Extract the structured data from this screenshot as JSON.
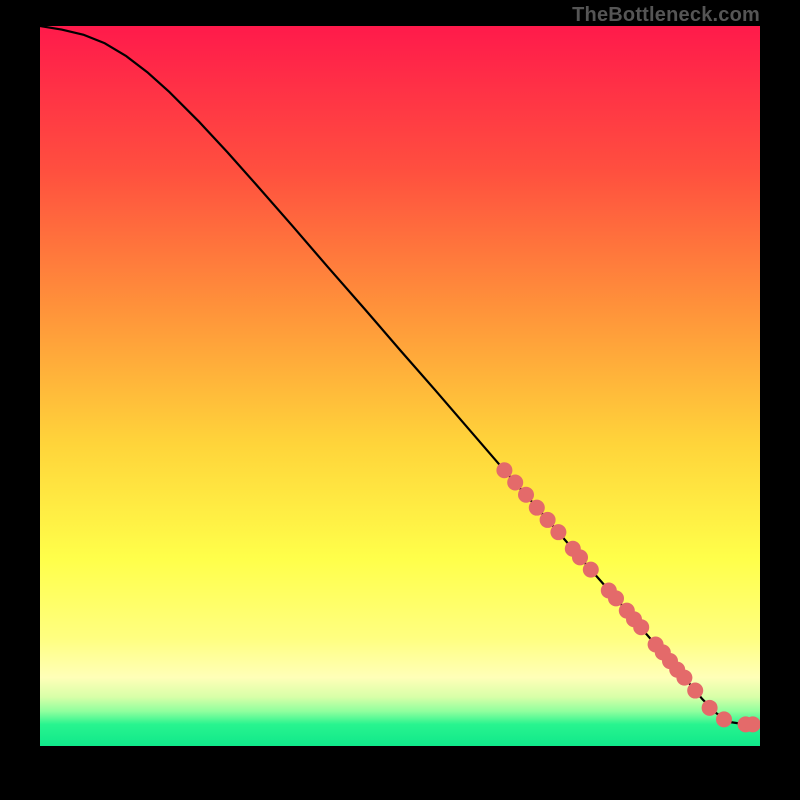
{
  "watermark": "TheBottleneck.com",
  "chart_data": {
    "type": "line",
    "title": "",
    "xlabel": "",
    "ylabel": "",
    "xlim": [
      0,
      100
    ],
    "ylim": [
      0,
      100
    ],
    "grid": false,
    "legend": false,
    "annotations": [],
    "gradient_stops": [
      {
        "offset": 0.0,
        "color": "#ff1a4b"
      },
      {
        "offset": 0.2,
        "color": "#ff4f3f"
      },
      {
        "offset": 0.4,
        "color": "#ff953a"
      },
      {
        "offset": 0.58,
        "color": "#ffd43a"
      },
      {
        "offset": 0.74,
        "color": "#ffff4a"
      },
      {
        "offset": 0.85,
        "color": "#ffff80"
      },
      {
        "offset": 0.905,
        "color": "#ffffb8"
      },
      {
        "offset": 0.932,
        "color": "#d8ffa8"
      },
      {
        "offset": 0.952,
        "color": "#8fff9e"
      },
      {
        "offset": 0.97,
        "color": "#28f48f"
      },
      {
        "offset": 1.0,
        "color": "#10e88a"
      }
    ],
    "series": [
      {
        "name": "curve",
        "type": "line",
        "color": "#000000",
        "x": [
          0,
          3,
          6,
          9,
          12,
          15,
          18,
          22,
          26,
          30,
          35,
          40,
          45,
          50,
          55,
          60,
          65,
          70,
          75,
          80,
          82,
          84,
          86,
          88,
          90,
          92,
          94,
          96,
          98,
          100
        ],
        "y": [
          100,
          99.5,
          98.8,
          97.6,
          95.8,
          93.5,
          90.8,
          86.8,
          82.5,
          78.0,
          72.3,
          66.5,
          60.8,
          55.0,
          49.3,
          43.5,
          37.7,
          32.0,
          26.2,
          20.5,
          18.2,
          15.8,
          13.5,
          11.2,
          8.9,
          6.5,
          4.5,
          3.3,
          3.0,
          3.0
        ]
      },
      {
        "name": "markers",
        "type": "scatter",
        "color": "#e46a6a",
        "x": [
          64.5,
          66.0,
          67.5,
          69.0,
          70.5,
          72.0,
          74.0,
          75.0,
          76.5,
          79.0,
          80.0,
          81.5,
          82.5,
          83.5,
          85.5,
          86.5,
          87.5,
          88.5,
          89.5,
          91.0,
          93.0,
          95.0,
          98.0,
          99.0
        ],
        "y": [
          38.3,
          36.6,
          34.9,
          33.1,
          31.4,
          29.7,
          27.4,
          26.2,
          24.5,
          21.6,
          20.5,
          18.8,
          17.6,
          16.5,
          14.1,
          13.0,
          11.8,
          10.6,
          9.5,
          7.7,
          5.3,
          3.7,
          3.0,
          3.0
        ]
      }
    ]
  }
}
